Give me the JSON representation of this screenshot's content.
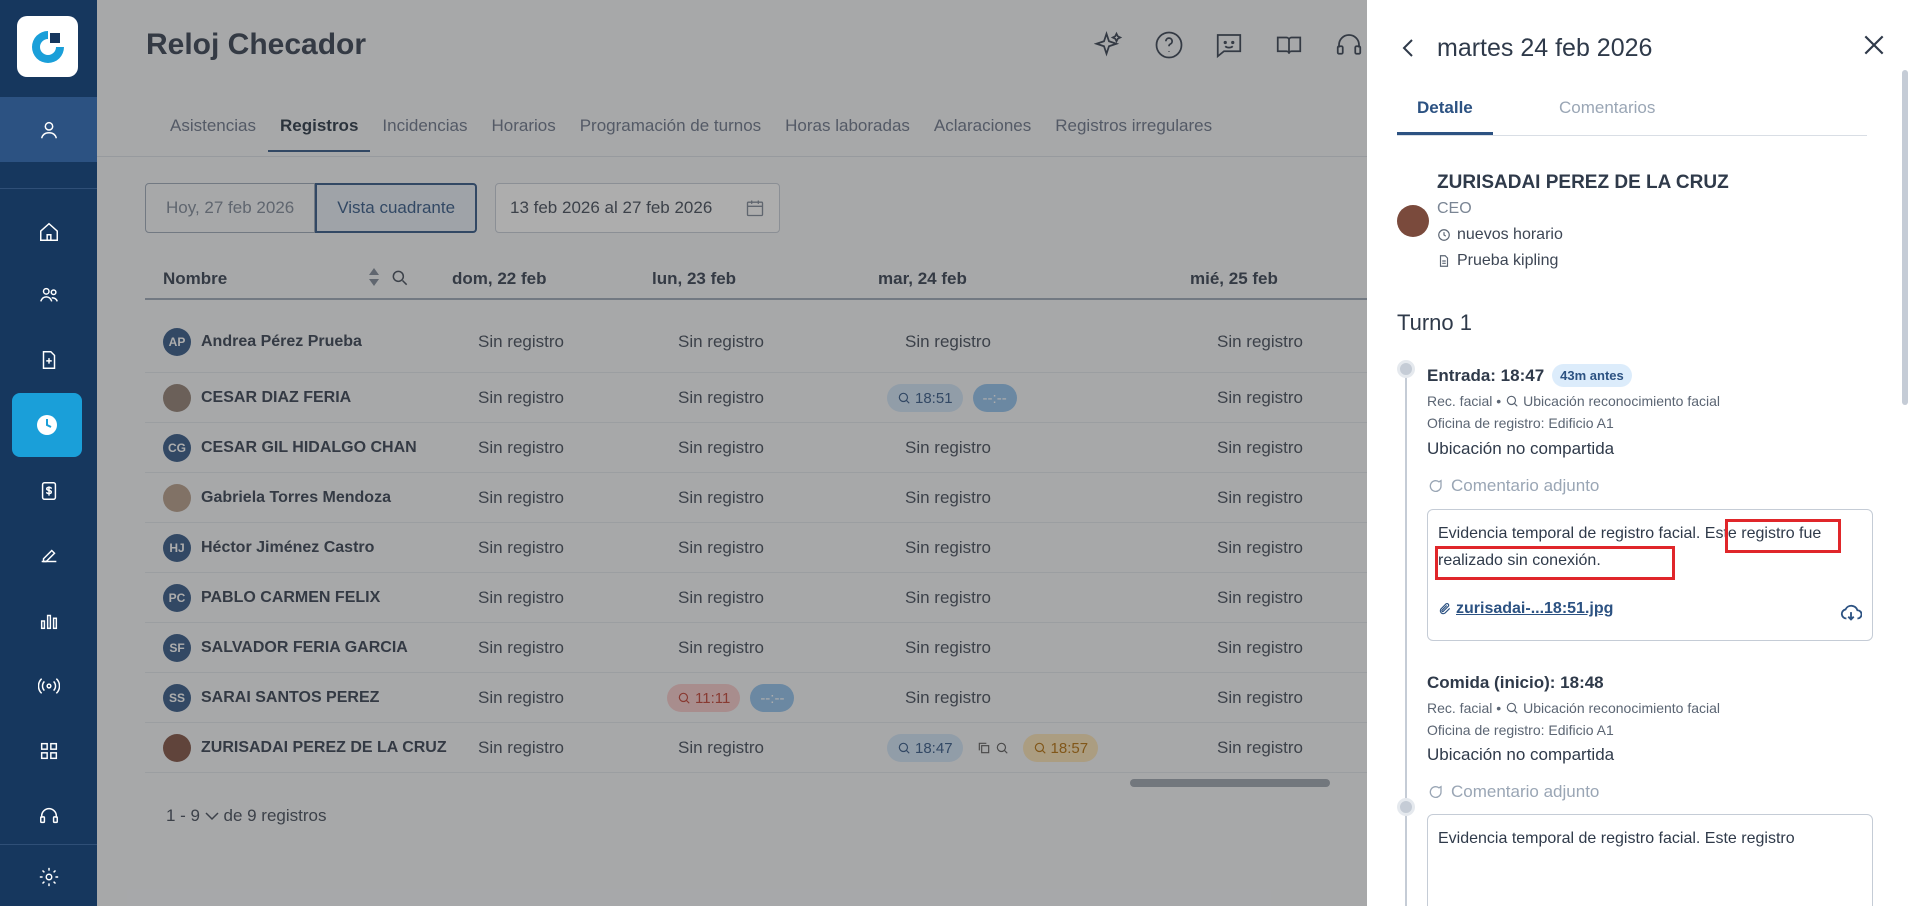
{
  "app": {
    "title": "Reloj Checador"
  },
  "colors": {
    "sidebar": "#16375e",
    "accent": "#2c5282",
    "active_item": "#1a9fd9",
    "highlight": "#e0262a"
  },
  "sidebar": {
    "items": [
      {
        "icon": "home-icon"
      },
      {
        "icon": "users-icon"
      },
      {
        "icon": "document-plus-icon"
      },
      {
        "icon": "clock-icon",
        "active": true
      },
      {
        "icon": "payroll-icon"
      },
      {
        "icon": "signature-icon"
      },
      {
        "icon": "chart-icon"
      },
      {
        "icon": "broadcast-icon"
      },
      {
        "icon": "apps-grid-icon"
      },
      {
        "icon": "support-icon"
      },
      {
        "icon": "settings-icon"
      }
    ]
  },
  "header": {
    "icons": [
      "sparkle-icon",
      "help-icon",
      "feedback-icon",
      "book-icon",
      "headset-icon"
    ]
  },
  "tabs": [
    {
      "label": "Asistencias"
    },
    {
      "label": "Registros",
      "active": true
    },
    {
      "label": "Incidencias"
    },
    {
      "label": "Horarios"
    },
    {
      "label": "Programación de turnos"
    },
    {
      "label": "Horas laboradas"
    },
    {
      "label": "Aclaraciones"
    },
    {
      "label": "Registros irregulares"
    }
  ],
  "toolbar": {
    "today_label": "Hoy, 27 feb 2026",
    "grid_view_label": "Vista cuadrante",
    "date_range": "13 feb 2026 al 27 feb 2026"
  },
  "table": {
    "columns": {
      "name": "Nombre",
      "d1": "dom, 22 feb",
      "d2": "lun, 23 feb",
      "d3": "mar, 24 feb",
      "d4": "mié, 25 feb"
    },
    "rows": [
      {
        "initials": "AP",
        "name": "Andrea Pérez Prueba",
        "d1": "Sin registro",
        "d2": "Sin registro",
        "d3": "Sin registro",
        "d4": "Sin registro"
      },
      {
        "initials": "",
        "name": "CESAR DIAZ FERIA",
        "d1": "Sin registro",
        "d2": "Sin registro",
        "d3_chip1": "18:51",
        "d3_chip2": "--:--",
        "d4": "Sin registro"
      },
      {
        "initials": "CG",
        "name": "CESAR GIL HIDALGO CHAN",
        "d1": "Sin registro",
        "d2": "Sin registro",
        "d3": "Sin registro",
        "d4": "Sin registro"
      },
      {
        "initials": "",
        "name": "Gabriela Torres Mendoza",
        "d1": "Sin registro",
        "d2": "Sin registro",
        "d3": "Sin registro",
        "d4": "Sin registro"
      },
      {
        "initials": "HJ",
        "name": "Héctor Jiménez Castro",
        "d1": "Sin registro",
        "d2": "Sin registro",
        "d3": "Sin registro",
        "d4": "Sin registro"
      },
      {
        "initials": "PC",
        "name": "PABLO CARMEN FELIX",
        "d1": "Sin registro",
        "d2": "Sin registro",
        "d3": "Sin registro",
        "d4": "Sin registro"
      },
      {
        "initials": "SF",
        "name": "SALVADOR FERIA GARCIA",
        "d1": "Sin registro",
        "d2": "Sin registro",
        "d3": "Sin registro",
        "d4": "Sin registro"
      },
      {
        "initials": "SS",
        "name": "SARAI SANTOS PEREZ",
        "d1": "Sin registro",
        "d2_chip1": "11:11",
        "d2_chip2": "--:--",
        "d3": "Sin registro",
        "d4": "Sin registro"
      },
      {
        "initials": "",
        "name": "ZURISADAI PEREZ DE LA CRUZ",
        "d1": "Sin registro",
        "d2": "Sin registro",
        "d3_chip1": "18:47",
        "d3_chip3": "18:57",
        "d4": "Sin registro"
      }
    ]
  },
  "pager": {
    "range": "1 - 9",
    "suffix": "de 9 registros"
  },
  "panel": {
    "date": "martes 24 feb 2026",
    "tabs": {
      "detail": "Detalle",
      "comments": "Comentarios"
    },
    "employee": {
      "name": "ZURISADAI PEREZ DE LA CRUZ",
      "role": "CEO",
      "schedule": "nuevos horario",
      "policy": "Prueba kipling"
    },
    "turno": "Turno 1",
    "events": [
      {
        "title": "Entrada: 18:47",
        "badge": "43m antes",
        "method": "Rec. facial •",
        "location_type": "Ubicación reconocimiento facial",
        "office": "Oficina de registro: Edificio A1",
        "location": "Ubicación no compartida",
        "comment_label": "Comentario adjunto",
        "comment": "Evidencia temporal de registro facial. Este registro fue realizado sin conexión.",
        "attachment": "zurisadai-...18:51.jpg"
      },
      {
        "title": "Comida (inicio): 18:48",
        "method": "Rec. facial •",
        "location_type": "Ubicación reconocimiento facial",
        "office": "Oficina de registro: Edificio A1",
        "location": "Ubicación no compartida",
        "comment_label": "Comentario adjunto",
        "comment": "Evidencia temporal de registro facial. Este registro"
      }
    ]
  }
}
